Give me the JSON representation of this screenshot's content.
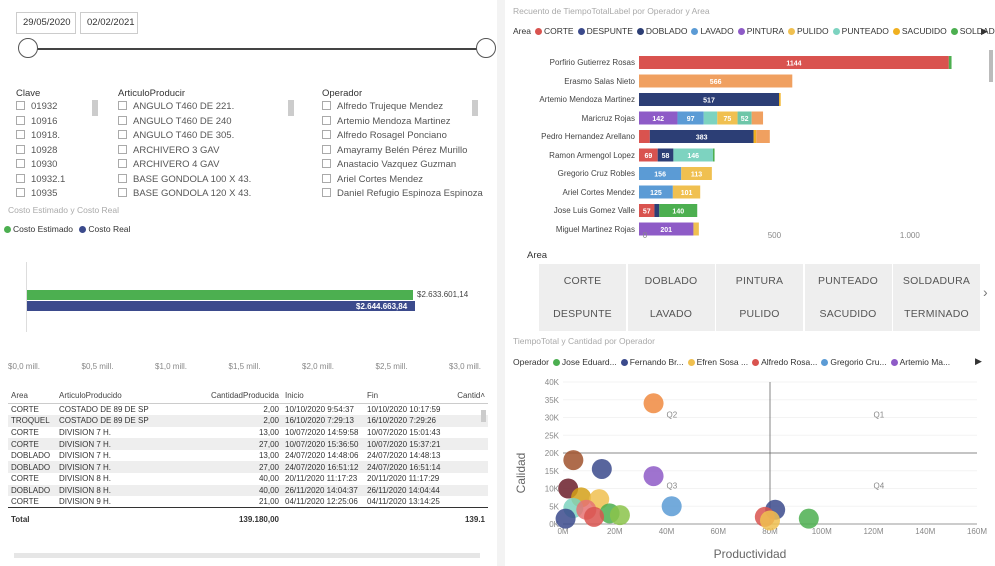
{
  "date_slicer": {
    "start": "29/05/2020",
    "end": "02/02/2021",
    "range_fraction": [
      0,
      1
    ]
  },
  "filters": {
    "clave": {
      "title": "Clave",
      "items": [
        "01932",
        "10916",
        "10918.",
        "10928",
        "10930",
        "10932.1",
        "10935"
      ]
    },
    "articulo": {
      "title": "ArticuloProducir",
      "items": [
        "ANGULO T460 DE 221.",
        "ANGULO T460 DE 240",
        "ANGULO T460 DE 305.",
        "ARCHIVERO 3 GAV",
        "ARCHIVERO 4 GAV",
        "BASE GONDOLA 100 X 43.",
        "BASE GONDOLA 120 X 43."
      ]
    },
    "operador": {
      "title": "Operador",
      "items": [
        "Alfredo Trujeque Mendez",
        "Artemio Mendoza Martinez",
        "Alfredo Rosagel Ponciano",
        "Amayramy Belén Pérez Murillo",
        "Anastacio Vazquez Guzman",
        "Ariel Cortes Mendez",
        "Daniel Refugio Espinoza Espinoza"
      ]
    }
  },
  "costo_chart": {
    "title": "Costo Estimado y Costo Real",
    "legend": [
      {
        "name": "Costo Estimado",
        "color": "#4caf50"
      },
      {
        "name": "Costo Real",
        "color": "#3b4a8c"
      }
    ],
    "value_labels": [
      "$2.633.601,14",
      "$2.644.663,84"
    ],
    "ticks": [
      "$0,0 mill.",
      "$0,5 mill.",
      "$1,0 mill.",
      "$1,5 mill.",
      "$2,0 mill.",
      "$2,5 mill.",
      "$3,0 mill."
    ]
  },
  "table": {
    "headers": [
      "Area",
      "ArticuloProducido",
      "CantidadProducida",
      "Inicio",
      "Fin",
      "Cantid"
    ],
    "rows": [
      [
        "CORTE",
        "COSTADO DE 89 DE SP",
        "2,00",
        "10/10/2020 9:54:37",
        "10/10/2020 10:17:59"
      ],
      [
        "TROQUEL",
        "COSTADO DE 89 DE SP",
        "2,00",
        "16/10/2020 7:29:13",
        "16/10/2020 7:29:26"
      ],
      [
        "CORTE",
        "DIVISION 7 H.",
        "13,00",
        "10/07/2020 14:59:58",
        "10/07/2020 15:01:43"
      ],
      [
        "CORTE",
        "DIVISION 7 H.",
        "27,00",
        "10/07/2020 15:36:50",
        "10/07/2020 15:37:21"
      ],
      [
        "DOBLADO",
        "DIVISION 7 H.",
        "13,00",
        "24/07/2020 14:48:06",
        "24/07/2020 14:48:13"
      ],
      [
        "DOBLADO",
        "DIVISION 7 H.",
        "27,00",
        "24/07/2020 16:51:12",
        "24/07/2020 16:51:14"
      ],
      [
        "CORTE",
        "DIVISION 8 H.",
        "40,00",
        "20/11/2020 11:17:23",
        "20/11/2020 11:17:29"
      ],
      [
        "DOBLADO",
        "DIVISION 8 H.",
        "40,00",
        "26/11/2020 14:04:37",
        "26/11/2020 14:04:44"
      ],
      [
        "CORTE",
        "DIVISION 9 H.",
        "21,00",
        "04/11/2020 12:25:06",
        "04/11/2020 13:14:25"
      ]
    ],
    "total_label": "Total",
    "total_value": "139.180,00",
    "total_cut": "139.1"
  },
  "recuento": {
    "title": "Recuento de TiempoTotalLabel por Operador y Area",
    "legend_title": "Area",
    "legend": [
      {
        "name": "CORTE",
        "color": "#d9534f"
      },
      {
        "name": "DESPUNTE",
        "color": "#3b4a8c"
      },
      {
        "name": "DOBLADO",
        "color": "#2c3e75"
      },
      {
        "name": "LAVADO",
        "color": "#5b9bd5"
      },
      {
        "name": "PINTURA",
        "color": "#8e5bc7"
      },
      {
        "name": "PULIDO",
        "color": "#f0c050"
      },
      {
        "name": "PUNTEADO",
        "color": "#7dd3c0"
      },
      {
        "name": "SACUDIDO",
        "color": "#f0b020"
      },
      {
        "name": "SOLDADU...",
        "color": "#4caf50"
      }
    ],
    "ticks": [
      "0",
      "500",
      "1.000"
    ]
  },
  "chart_data": [
    {
      "type": "bar",
      "orientation": "horizontal",
      "title": "Recuento de TiempoTotalLabel por Operador y Area",
      "categories": [
        "Porfirio Gutierrez Rosas",
        "Erasmo Salas Nieto",
        "Artemio Mendoza Martinez",
        "Maricruz Rojas",
        "Pedro Hernandez Arellano",
        "Ramon Armengol Lopez",
        "Gregorio Cruz Robles",
        "Ariel Cortes Mendez",
        "Jose Luis Gomez Valle",
        "Miguel Martinez Rojas"
      ],
      "xlim": [
        0,
        1200
      ],
      "segments": [
        [
          {
            "area": "CORTE",
            "value": 1144,
            "label": "1144"
          },
          {
            "area": "SOLDADU...",
            "value": 10
          }
        ],
        [
          {
            "area": "ORANGE",
            "value": 566,
            "label": "566"
          }
        ],
        [
          {
            "area": "DOBLADO",
            "value": 517,
            "label": "517"
          },
          {
            "area": "SACUDIDO",
            "value": 6
          }
        ],
        [
          {
            "area": "PINTURA",
            "value": 142,
            "label": "142"
          },
          {
            "area": "LAVADO",
            "value": 97,
            "label": "97"
          },
          {
            "area": "PUNTEADO",
            "value": 50
          },
          {
            "area": "PULIDO",
            "value": 75,
            "label": "75"
          },
          {
            "area": "PUNTEADO2",
            "value": 52,
            "label": "52"
          },
          {
            "area": "ORANGE",
            "value": 42
          }
        ],
        [
          {
            "area": "CORTE",
            "value": 40
          },
          {
            "area": "DOBLADO",
            "value": 383,
            "label": "383"
          },
          {
            "area": "SACUDIDO",
            "value": 10
          },
          {
            "area": "ORANGE",
            "value": 50
          }
        ],
        [
          {
            "area": "CORTE",
            "value": 69,
            "label": "69"
          },
          {
            "area": "DOBLADO",
            "value": 58,
            "label": "58"
          },
          {
            "area": "PUNTEADO",
            "value": 146,
            "label": "146"
          },
          {
            "area": "SOLDADU...",
            "value": 6
          }
        ],
        [
          {
            "area": "LAVADO",
            "value": 156,
            "label": "156"
          },
          {
            "area": "PULIDO",
            "value": 113,
            "label": "113"
          }
        ],
        [
          {
            "area": "LAVADO",
            "value": 125,
            "label": "125"
          },
          {
            "area": "PULIDO",
            "value": 101,
            "label": "101"
          }
        ],
        [
          {
            "area": "CORTE",
            "value": 57,
            "label": "57"
          },
          {
            "area": "DOBLADO",
            "value": 18
          },
          {
            "area": "SOLDADU...",
            "value": 140,
            "label": "140"
          }
        ],
        [
          {
            "area": "PINTURA",
            "value": 201,
            "label": "201"
          },
          {
            "area": "PULIDO",
            "value": 20
          }
        ]
      ]
    },
    {
      "type": "scatter",
      "title": "TiempoTotal y Cantidad por Operador",
      "xlabel": "Productividad",
      "ylabel": "Calidad",
      "xlim": [
        0,
        160
      ],
      "ylim": [
        0,
        40
      ],
      "x_ticks": [
        "0M",
        "20M",
        "40M",
        "60M",
        "80M",
        "100M",
        "120M",
        "140M",
        "160M"
      ],
      "y_ticks": [
        "0K",
        "5K",
        "10K",
        "15K",
        "20K",
        "25K",
        "30K",
        "35K",
        "40K"
      ],
      "quadrant_x": 80,
      "quadrant_y": 20,
      "quadrant_labels": [
        "Q1",
        "Q2",
        "Q3",
        "Q4"
      ],
      "points": [
        {
          "x": 35,
          "y": 34,
          "color": "#f08a40"
        },
        {
          "x": 4,
          "y": 18,
          "color": "#a0522d"
        },
        {
          "x": 15,
          "y": 15.5,
          "color": "#3b4a8c"
        },
        {
          "x": 35,
          "y": 13.5,
          "color": "#8e5bc7"
        },
        {
          "x": 2,
          "y": 10,
          "color": "#6b1f2a"
        },
        {
          "x": 7,
          "y": 7.5,
          "color": "#d4a017"
        },
        {
          "x": 14,
          "y": 7,
          "color": "#f0c050"
        },
        {
          "x": 42,
          "y": 5,
          "color": "#5b9bd5"
        },
        {
          "x": 4,
          "y": 4.5,
          "color": "#7dd3c0"
        },
        {
          "x": 9,
          "y": 4,
          "color": "#e57373"
        },
        {
          "x": 18,
          "y": 3,
          "color": "#4caf50"
        },
        {
          "x": 12,
          "y": 2,
          "color": "#d9534f"
        },
        {
          "x": 1,
          "y": 1.5,
          "color": "#3b4a8c"
        },
        {
          "x": 22,
          "y": 2.5,
          "color": "#8bc34a"
        },
        {
          "x": 82,
          "y": 4,
          "color": "#3b4a8c"
        },
        {
          "x": 78,
          "y": 2,
          "color": "#d9534f"
        },
        {
          "x": 80,
          "y": 1,
          "color": "#f0c050"
        },
        {
          "x": 95,
          "y": 1.5,
          "color": "#4caf50"
        }
      ]
    }
  ],
  "area_slicer": {
    "title": "Area",
    "tiles": [
      "CORTE",
      "DOBLADO",
      "PINTURA",
      "PUNTEADO",
      "SOLDADURA",
      "DESPUNTE",
      "LAVADO",
      "PULIDO",
      "SACUDIDO",
      "TERMINADO"
    ]
  },
  "scatter": {
    "title": "TiempoTotal y Cantidad por Operador",
    "legend_title": "Operador",
    "legend": [
      {
        "name": "Jose Eduard...",
        "color": "#4caf50"
      },
      {
        "name": "Fernando Br...",
        "color": "#3b4a8c"
      },
      {
        "name": "Efren Sosa ...",
        "color": "#f0c050"
      },
      {
        "name": "Alfredo Rosa...",
        "color": "#d9534f"
      },
      {
        "name": "Gregorio Cru...",
        "color": "#5b9bd5"
      },
      {
        "name": "Artemio Ma...",
        "color": "#8e5bc7"
      }
    ]
  }
}
